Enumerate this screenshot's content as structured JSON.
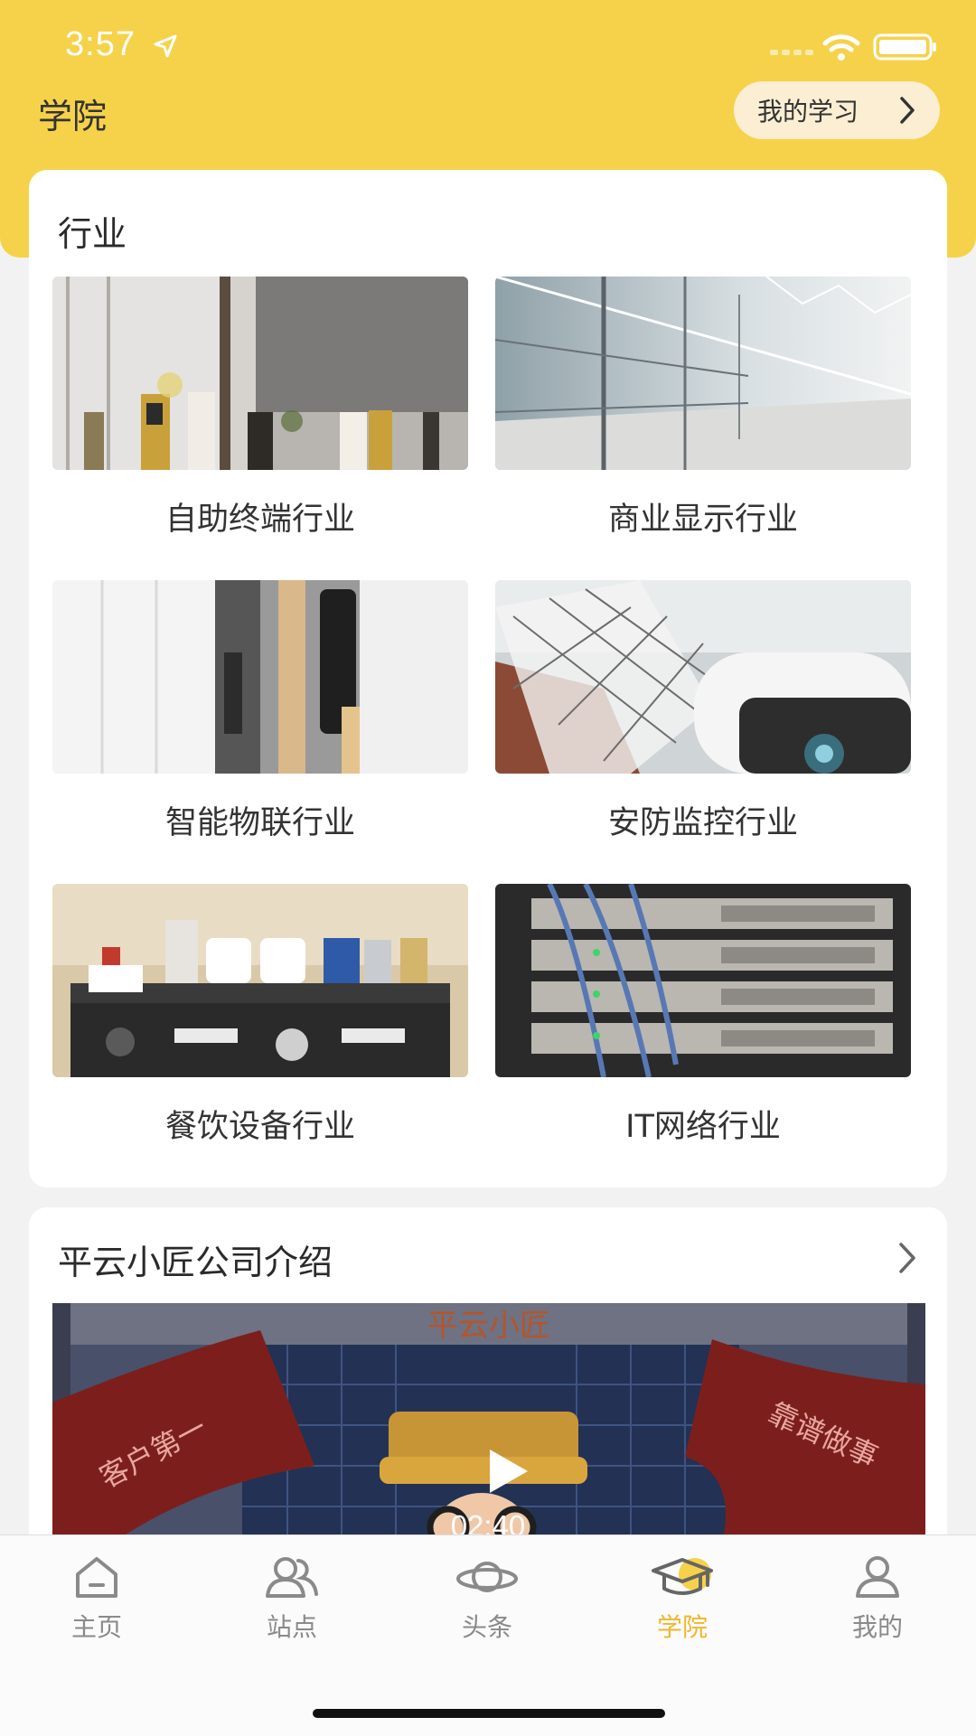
{
  "status_bar": {
    "time": "3:57"
  },
  "header": {
    "title": "学院",
    "my_study_label": "我的学习"
  },
  "industry": {
    "title": "行业",
    "tiles": [
      {
        "label": "自助终端行业"
      },
      {
        "label": "商业显示行业"
      },
      {
        "label": "智能物联行业"
      },
      {
        "label": "安防监控行业"
      },
      {
        "label": "餐饮设备行业"
      },
      {
        "label": "IT网络行业"
      }
    ]
  },
  "company": {
    "title": "平云小匠公司介绍",
    "video": {
      "duration": "02:40",
      "brand_text": "平云小匠",
      "left_flag_text": "客户第一",
      "right_flag_text": "靠谱做事"
    }
  },
  "tabbar": {
    "tabs": [
      {
        "label": "主页",
        "icon": "home-icon"
      },
      {
        "label": "站点",
        "icon": "users-icon"
      },
      {
        "label": "头条",
        "icon": "planet-icon"
      },
      {
        "label": "学院",
        "icon": "graduation-cap-icon"
      },
      {
        "label": "我的",
        "icon": "user-icon"
      }
    ],
    "active_index": 3
  },
  "colors": {
    "brand_yellow": "#f6d24a",
    "active_tab": "#f2b62b",
    "inactive_tab": "#8a8a8a"
  }
}
